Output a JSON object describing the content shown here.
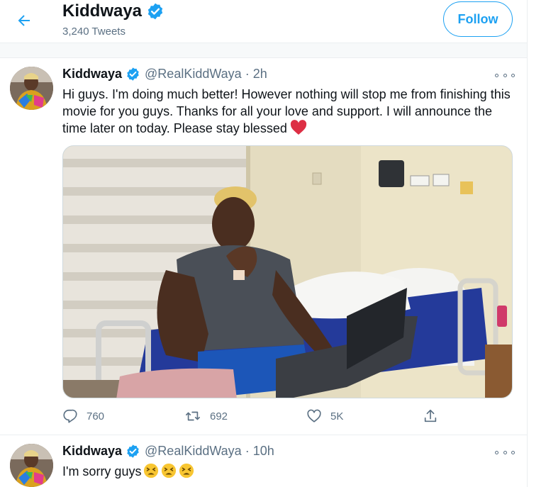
{
  "header": {
    "name": "Kiddwaya",
    "tweet_count": "3,240 Tweets",
    "follow_label": "Follow"
  },
  "tweets": [
    {
      "name": "Kiddwaya",
      "handle": "@RealKiddWaya",
      "separator": "·",
      "time": "2h",
      "text": "Hi guys. I'm doing much better! However nothing will stop me from finishing this movie for you guys. Thanks for all your love and support. I will announce the time later on today. Please stay blessed",
      "emoji": "red-heart",
      "has_photo": true,
      "replies": "760",
      "retweets": "692",
      "likes": "5K"
    },
    {
      "name": "Kiddwaya",
      "handle": "@RealKiddWaya",
      "separator": "·",
      "time": "10h",
      "text": "I'm sorry guys",
      "emoji": "tired-face x3"
    }
  ],
  "colors": {
    "accent": "#1da1f2",
    "secondary_text": "#5b7083",
    "primary_text": "#0f1419",
    "heart": "#e0245e"
  },
  "icons": [
    "back-arrow-icon",
    "verified-badge-icon",
    "more-icon",
    "reply-icon",
    "retweet-icon",
    "like-icon",
    "share-icon"
  ]
}
